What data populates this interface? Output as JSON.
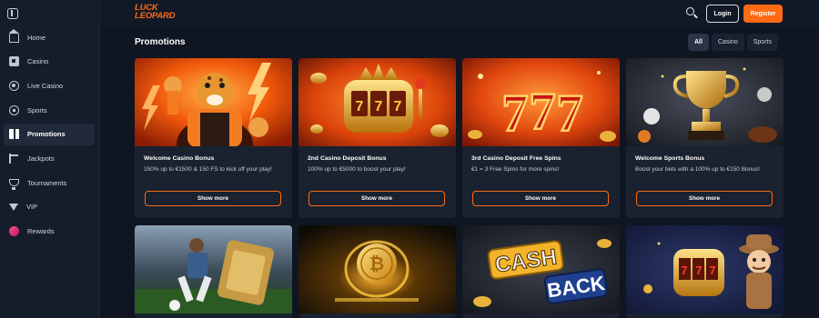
{
  "header": {
    "logo_line1": "LUCK",
    "logo_line2": "LEOPARD",
    "login_label": "Login",
    "register_label": "Register",
    "accent_color": "#ff6a14"
  },
  "sidebar": {
    "items": [
      {
        "label": "Home",
        "icon": "home-icon",
        "active": false
      },
      {
        "label": "Casino",
        "icon": "casino-icon",
        "active": false
      },
      {
        "label": "Live Casino",
        "icon": "live-casino-icon",
        "active": false
      },
      {
        "label": "Sports",
        "icon": "sports-icon",
        "active": false
      },
      {
        "label": "Promotions",
        "icon": "gift-icon",
        "active": true
      },
      {
        "label": "Jackpots",
        "icon": "jackpot-icon",
        "active": false
      },
      {
        "label": "Tournaments",
        "icon": "trophy-icon",
        "active": false
      },
      {
        "label": "VIP",
        "icon": "vip-icon",
        "active": false
      },
      {
        "label": "Rewards",
        "icon": "rewards-icon",
        "active": false
      }
    ]
  },
  "main": {
    "title": "Promotions",
    "filters": [
      {
        "label": "All",
        "active": true
      },
      {
        "label": "Casino",
        "active": false
      },
      {
        "label": "Sports",
        "active": false
      }
    ],
    "cards": [
      {
        "title": "Welcome Casino Bonus",
        "description": "150% up to €1500 & 150 FS to kick off your play!",
        "button": "Show more",
        "image": "leopard-fighter-illustration"
      },
      {
        "title": "2nd Casino Deposit Bonus",
        "description": "100% up to €5000 to boost your play!",
        "button": "Show more",
        "image": "golden-slot-machine-illustration"
      },
      {
        "title": "3rd Casino Deposit Free Spins",
        "description": "€1 = 3 Free Spins for more spins!",
        "button": "Show more",
        "image": "lucky-777-illustration"
      },
      {
        "title": "Welcome Sports Bonus",
        "description": "Boost your bets with a 100% up to €150 Bonus!",
        "button": "Show more",
        "image": "golden-trophy-illustration"
      },
      {
        "image": "footballer-ticket-illustration"
      },
      {
        "image": "bitcoin-coin-illustration"
      },
      {
        "image": "cashback-illustration",
        "art_text_1": "CASH",
        "art_text_2": "BACK"
      },
      {
        "image": "slot-detective-illustration"
      }
    ]
  }
}
